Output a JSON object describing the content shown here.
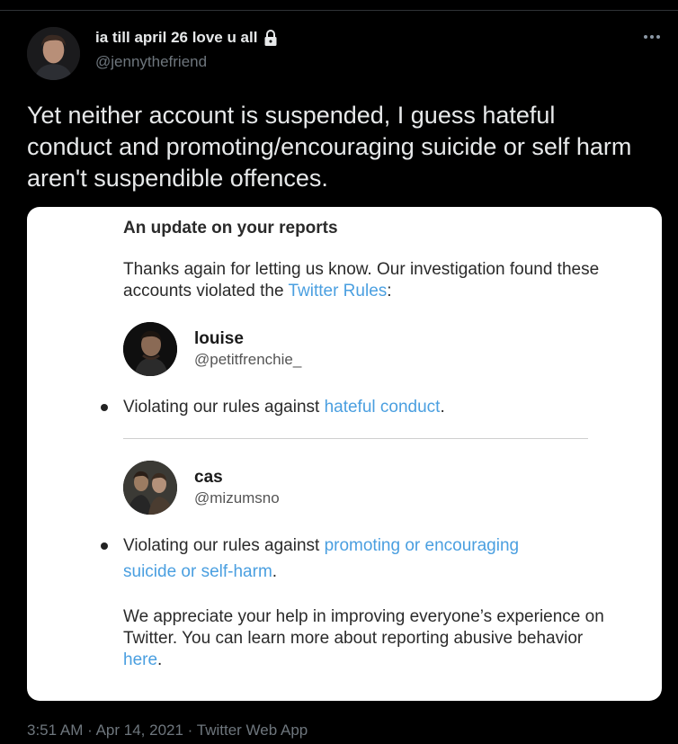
{
  "tweet": {
    "display_name": "ia till april 26 love u all",
    "handle": "@jennythefriend",
    "text": "Yet neither account is suspended, I guess hateful conduct and promoting/encouraging suicide or self harm aren't suspendible offences.",
    "time": "3:51 AM",
    "separator": "·",
    "date": "Apr 14, 2021",
    "source": "Twitter Web App"
  },
  "card": {
    "title": "An update on your reports",
    "intro_text": "Thanks again for letting us know. Our investigation found these accounts violated the ",
    "intro_link": "Twitter Rules",
    "intro_end": ":",
    "accounts": [
      {
        "name": "louise",
        "handle": "@petitfrenchie_",
        "violation_prefix": "Violating our rules against ",
        "violation_link": "hateful conduct",
        "violation_suffix": "."
      },
      {
        "name": "cas",
        "handle": "@mizumsno",
        "violation_prefix": "Violating our rules against ",
        "violation_link": "promoting or encouraging suicide or self-harm",
        "violation_suffix": "."
      }
    ],
    "footer_text": "We appreciate your help in improving everyone’s experience on Twitter. You can learn more about reporting abusive behavior ",
    "footer_link": "here",
    "footer_end": "."
  },
  "icons": {
    "lock": "lock-icon",
    "more": "more-options-icon"
  },
  "colors": {
    "background": "#000000",
    "link": "#4a9fe0",
    "muted": "#6e767d"
  }
}
